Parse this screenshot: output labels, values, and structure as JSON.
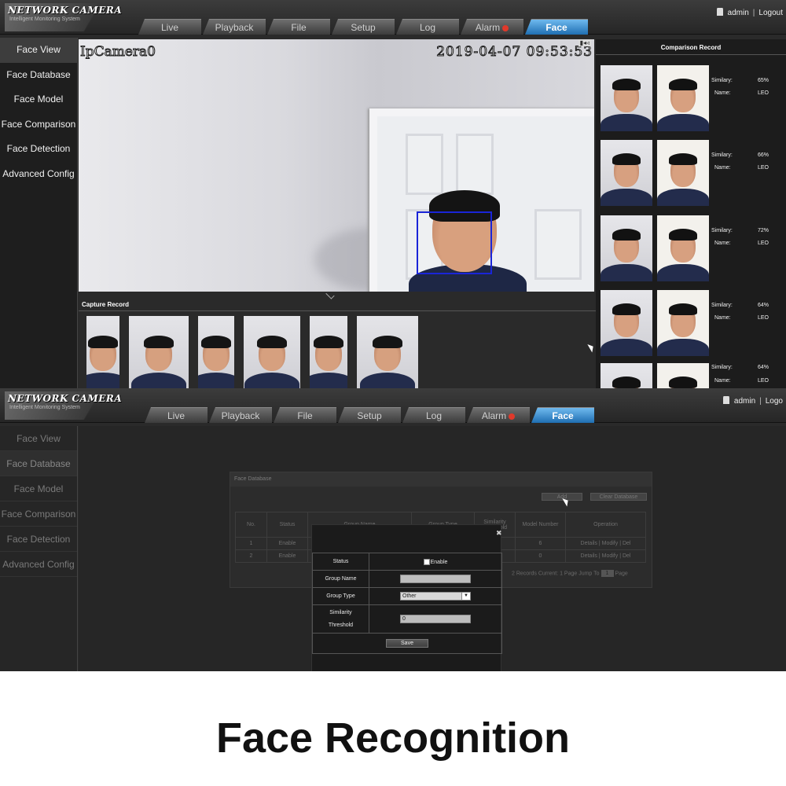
{
  "shot1": {
    "brand": {
      "name": "NETWORK CAMERA",
      "sub": "Intelligent Monitoring System"
    },
    "tabs": [
      {
        "label": "Live"
      },
      {
        "label": "Playback"
      },
      {
        "label": "File"
      },
      {
        "label": "Setup"
      },
      {
        "label": "Log"
      },
      {
        "label": "Alarm"
      },
      {
        "label": "Face"
      }
    ],
    "user": {
      "name": "admin",
      "logout": "Logout"
    },
    "sidebar": [
      {
        "label": "Face View"
      },
      {
        "label": "Face Database"
      },
      {
        "label": "Face Model"
      },
      {
        "label": "Face Comparison"
      },
      {
        "label": "Face Detection"
      },
      {
        "label": "Advanced Config"
      }
    ],
    "video": {
      "camera_name": "IpCamera0",
      "timestamp": "2019-04-07  09:53:53",
      "status_icons": "▮◂◃"
    },
    "capture_record": {
      "title": "Capture Record"
    },
    "comparison_record": {
      "title": "Comparison Record",
      "similarity_label": "Similary:",
      "name_label": "Name:",
      "rows": [
        {
          "similarity": "65%",
          "name": "LEO"
        },
        {
          "similarity": "66%",
          "name": "LEO"
        },
        {
          "similarity": "72%",
          "name": "LEO"
        },
        {
          "similarity": "64%",
          "name": "LEO"
        },
        {
          "similarity": "64%",
          "name": "LEO"
        }
      ]
    }
  },
  "shot2": {
    "brand": {
      "name": "NETWORK CAMERA",
      "sub": "Intelligent Monitoring System"
    },
    "tabs": [
      {
        "label": "Live"
      },
      {
        "label": "Playback"
      },
      {
        "label": "File"
      },
      {
        "label": "Setup"
      },
      {
        "label": "Log"
      },
      {
        "label": "Alarm"
      },
      {
        "label": "Face"
      }
    ],
    "user": {
      "name": "admin",
      "logout": "Logo"
    },
    "sidebar": [
      {
        "label": "Face View"
      },
      {
        "label": "Face Database"
      },
      {
        "label": "Face Model"
      },
      {
        "label": "Face Comparison"
      },
      {
        "label": "Face Detection"
      },
      {
        "label": "Advanced Config"
      }
    ],
    "db": {
      "title": "Face Database",
      "add_label": "Add",
      "clear_label": "Clear Database",
      "columns": [
        "No.",
        "Status",
        "Group Name",
        "Group Type",
        "Similarity Threshold",
        "Model Number",
        "Operation"
      ],
      "rows": [
        {
          "no": "1",
          "status": "Enable",
          "model": "6",
          "ops": "Details | Modify | Del"
        },
        {
          "no": "2",
          "status": "Enable",
          "model": "0",
          "ops": "Details | Modify | Del"
        }
      ],
      "pager": {
        "text": "2 Records  Current: 1 Page  Jump To",
        "page": "1",
        "suffix": "Page"
      }
    },
    "modal": {
      "close": "✖",
      "status_label": "Status",
      "enable_label": "Enable",
      "group_name_label": "Group Name",
      "group_name_value": "",
      "group_type_label": "Group Type",
      "group_type_value": "Other",
      "threshold_label_1": "Similarity",
      "threshold_label_2": "Threshold",
      "threshold_value": "0",
      "save_label": "Save"
    }
  },
  "caption": "Face Recognition",
  "colors": {
    "tab_active": "#1f6fb2",
    "face_box": "#1a25d8",
    "alarm": "#e0392b"
  }
}
